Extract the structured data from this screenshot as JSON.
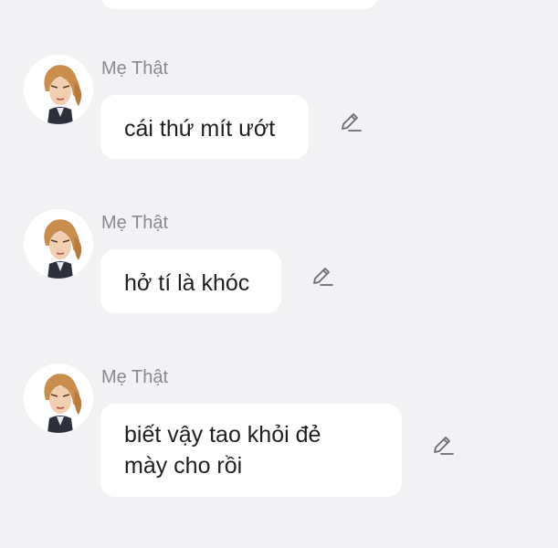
{
  "messages": [
    {
      "sender": "Mẹ Thật",
      "text": "cái thứ mít ướt",
      "avatar_icon": "woman-portrait-avatar",
      "action_icon": "pencil-edit-icon"
    },
    {
      "sender": "Mẹ Thật",
      "text": "hở tí là khóc",
      "avatar_icon": "woman-portrait-avatar",
      "action_icon": "pencil-edit-icon"
    },
    {
      "sender": "Mẹ Thật",
      "text_line1": "biết vậy tao khỏi đẻ",
      "text_line2": "mày cho rồi",
      "avatar_icon": "woman-portrait-avatar",
      "action_icon": "pencil-edit-icon"
    }
  ],
  "colors": {
    "background": "#f2f2f4",
    "bubble": "#ffffff",
    "sender_text": "#8a8a8e",
    "message_text": "#1f1f1f",
    "icon": "#6b6b6e"
  }
}
